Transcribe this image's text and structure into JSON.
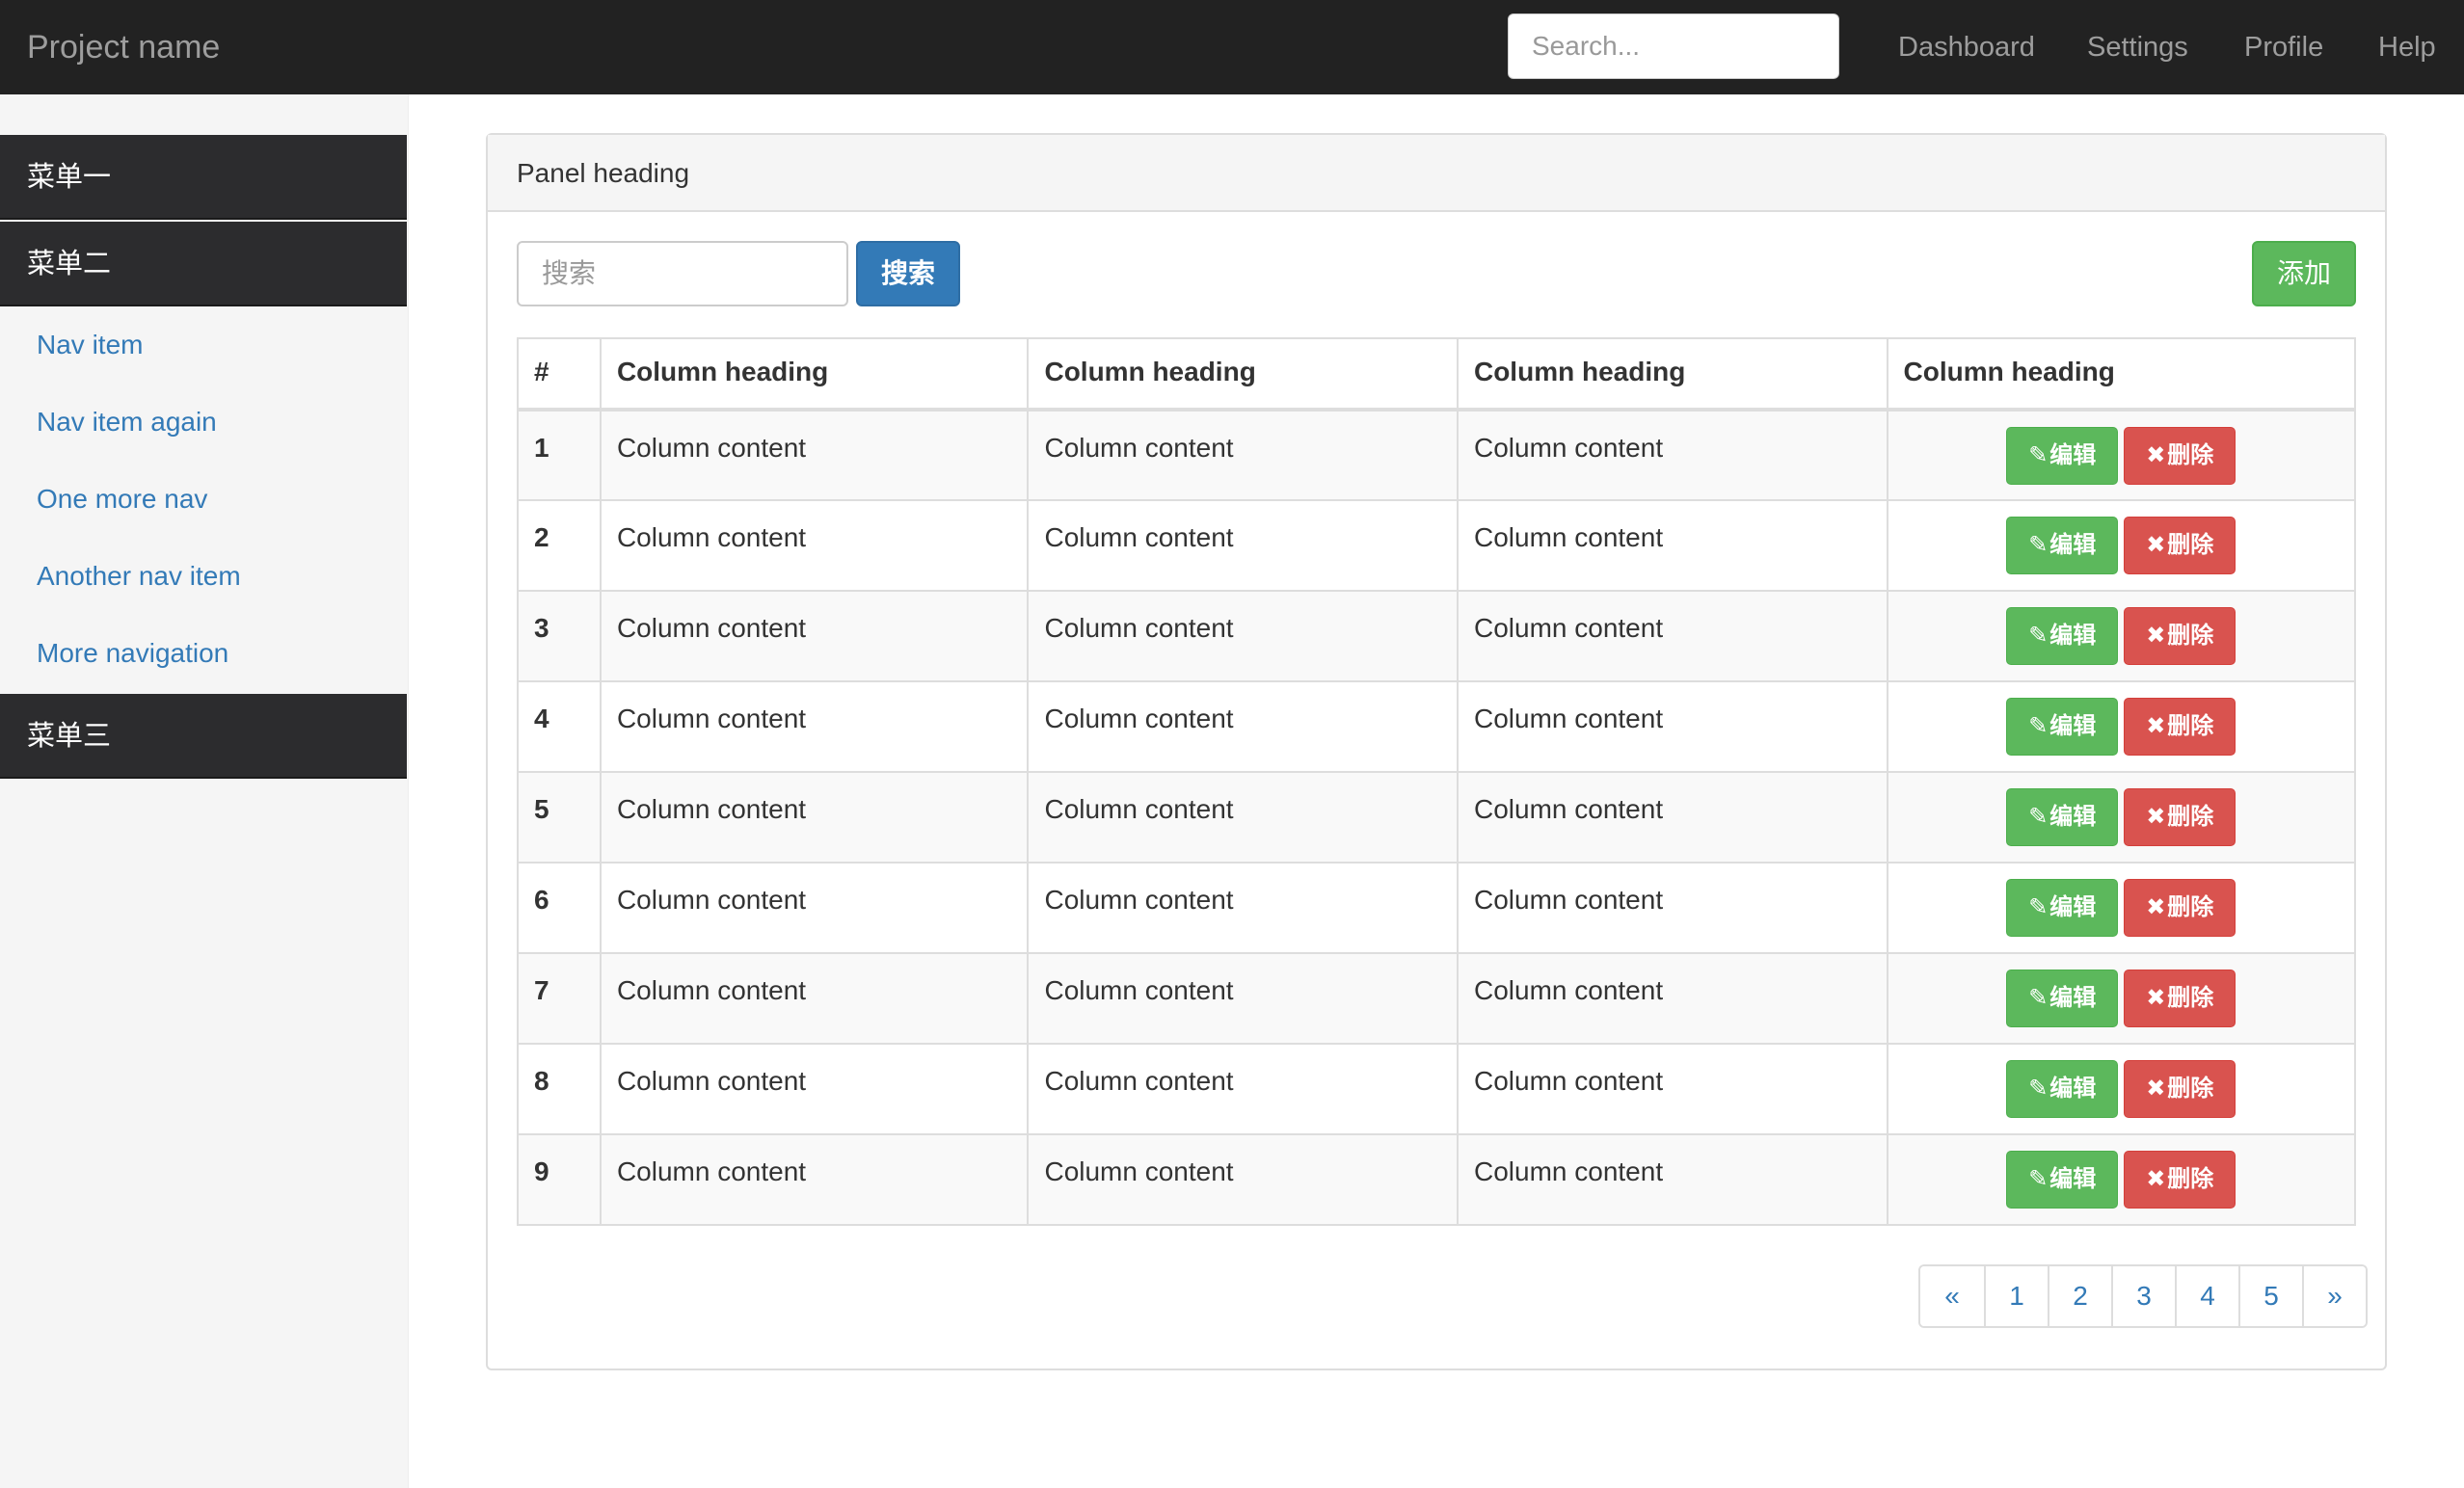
{
  "navbar": {
    "brand": "Project name",
    "search_placeholder": "Search...",
    "links": [
      "Dashboard",
      "Settings",
      "Profile",
      "Help"
    ]
  },
  "sidebar": {
    "menu1": "菜单一",
    "menu2": "菜单二",
    "items": [
      "Nav item",
      "Nav item again",
      "One more nav",
      "Another nav item",
      "More navigation"
    ],
    "menu3": "菜单三"
  },
  "panel": {
    "heading": "Panel heading",
    "search_placeholder": "搜索",
    "search_button": "搜索",
    "add_button": "添加",
    "table": {
      "headers": [
        "#",
        "Column heading",
        "Column heading",
        "Column heading",
        "Column heading"
      ],
      "rows": [
        {
          "num": "1",
          "c1": "Column content",
          "c2": "Column content",
          "c3": "Column content"
        },
        {
          "num": "2",
          "c1": "Column content",
          "c2": "Column content",
          "c3": "Column content"
        },
        {
          "num": "3",
          "c1": "Column content",
          "c2": "Column content",
          "c3": "Column content"
        },
        {
          "num": "4",
          "c1": "Column content",
          "c2": "Column content",
          "c3": "Column content"
        },
        {
          "num": "5",
          "c1": "Column content",
          "c2": "Column content",
          "c3": "Column content"
        },
        {
          "num": "6",
          "c1": "Column content",
          "c2": "Column content",
          "c3": "Column content"
        },
        {
          "num": "7",
          "c1": "Column content",
          "c2": "Column content",
          "c3": "Column content"
        },
        {
          "num": "8",
          "c1": "Column content",
          "c2": "Column content",
          "c3": "Column content"
        },
        {
          "num": "9",
          "c1": "Column content",
          "c2": "Column content",
          "c3": "Column content"
        }
      ],
      "edit_label": "编辑",
      "delete_label": "删除",
      "edit_icon": "pencil-icon",
      "delete_icon": "remove-icon"
    },
    "pagination": [
      "«",
      "1",
      "2",
      "3",
      "4",
      "5",
      "»"
    ]
  },
  "colors": {
    "navbar_bg": "#222222",
    "menu_bg": "#2c2c2e",
    "link": "#337ab7",
    "primary": "#337ab7",
    "success": "#5cb85c",
    "danger": "#d9534f"
  }
}
